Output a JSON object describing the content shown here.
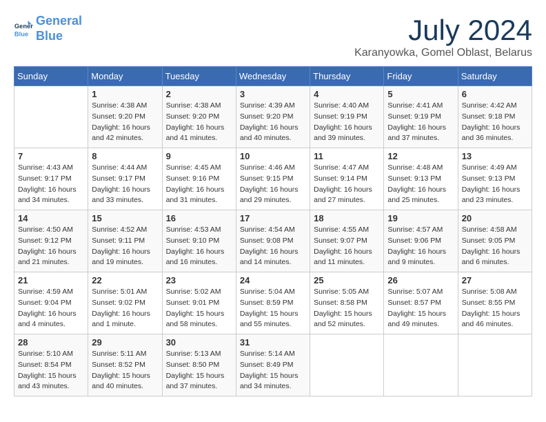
{
  "header": {
    "logo_line1": "General",
    "logo_line2": "Blue",
    "month_title": "July 2024",
    "subtitle": "Karanyowka, Gomel Oblast, Belarus"
  },
  "weekdays": [
    "Sunday",
    "Monday",
    "Tuesday",
    "Wednesday",
    "Thursday",
    "Friday",
    "Saturday"
  ],
  "weeks": [
    [
      {
        "day": "",
        "sunrise": "",
        "sunset": "",
        "daylight": ""
      },
      {
        "day": "1",
        "sunrise": "Sunrise: 4:38 AM",
        "sunset": "Sunset: 9:20 PM",
        "daylight": "Daylight: 16 hours and 42 minutes."
      },
      {
        "day": "2",
        "sunrise": "Sunrise: 4:38 AM",
        "sunset": "Sunset: 9:20 PM",
        "daylight": "Daylight: 16 hours and 41 minutes."
      },
      {
        "day": "3",
        "sunrise": "Sunrise: 4:39 AM",
        "sunset": "Sunset: 9:20 PM",
        "daylight": "Daylight: 16 hours and 40 minutes."
      },
      {
        "day": "4",
        "sunrise": "Sunrise: 4:40 AM",
        "sunset": "Sunset: 9:19 PM",
        "daylight": "Daylight: 16 hours and 39 minutes."
      },
      {
        "day": "5",
        "sunrise": "Sunrise: 4:41 AM",
        "sunset": "Sunset: 9:19 PM",
        "daylight": "Daylight: 16 hours and 37 minutes."
      },
      {
        "day": "6",
        "sunrise": "Sunrise: 4:42 AM",
        "sunset": "Sunset: 9:18 PM",
        "daylight": "Daylight: 16 hours and 36 minutes."
      }
    ],
    [
      {
        "day": "7",
        "sunrise": "Sunrise: 4:43 AM",
        "sunset": "Sunset: 9:17 PM",
        "daylight": "Daylight: 16 hours and 34 minutes."
      },
      {
        "day": "8",
        "sunrise": "Sunrise: 4:44 AM",
        "sunset": "Sunset: 9:17 PM",
        "daylight": "Daylight: 16 hours and 33 minutes."
      },
      {
        "day": "9",
        "sunrise": "Sunrise: 4:45 AM",
        "sunset": "Sunset: 9:16 PM",
        "daylight": "Daylight: 16 hours and 31 minutes."
      },
      {
        "day": "10",
        "sunrise": "Sunrise: 4:46 AM",
        "sunset": "Sunset: 9:15 PM",
        "daylight": "Daylight: 16 hours and 29 minutes."
      },
      {
        "day": "11",
        "sunrise": "Sunrise: 4:47 AM",
        "sunset": "Sunset: 9:14 PM",
        "daylight": "Daylight: 16 hours and 27 minutes."
      },
      {
        "day": "12",
        "sunrise": "Sunrise: 4:48 AM",
        "sunset": "Sunset: 9:13 PM",
        "daylight": "Daylight: 16 hours and 25 minutes."
      },
      {
        "day": "13",
        "sunrise": "Sunrise: 4:49 AM",
        "sunset": "Sunset: 9:13 PM",
        "daylight": "Daylight: 16 hours and 23 minutes."
      }
    ],
    [
      {
        "day": "14",
        "sunrise": "Sunrise: 4:50 AM",
        "sunset": "Sunset: 9:12 PM",
        "daylight": "Daylight: 16 hours and 21 minutes."
      },
      {
        "day": "15",
        "sunrise": "Sunrise: 4:52 AM",
        "sunset": "Sunset: 9:11 PM",
        "daylight": "Daylight: 16 hours and 19 minutes."
      },
      {
        "day": "16",
        "sunrise": "Sunrise: 4:53 AM",
        "sunset": "Sunset: 9:10 PM",
        "daylight": "Daylight: 16 hours and 16 minutes."
      },
      {
        "day": "17",
        "sunrise": "Sunrise: 4:54 AM",
        "sunset": "Sunset: 9:08 PM",
        "daylight": "Daylight: 16 hours and 14 minutes."
      },
      {
        "day": "18",
        "sunrise": "Sunrise: 4:55 AM",
        "sunset": "Sunset: 9:07 PM",
        "daylight": "Daylight: 16 hours and 11 minutes."
      },
      {
        "day": "19",
        "sunrise": "Sunrise: 4:57 AM",
        "sunset": "Sunset: 9:06 PM",
        "daylight": "Daylight: 16 hours and 9 minutes."
      },
      {
        "day": "20",
        "sunrise": "Sunrise: 4:58 AM",
        "sunset": "Sunset: 9:05 PM",
        "daylight": "Daylight: 16 hours and 6 minutes."
      }
    ],
    [
      {
        "day": "21",
        "sunrise": "Sunrise: 4:59 AM",
        "sunset": "Sunset: 9:04 PM",
        "daylight": "Daylight: 16 hours and 4 minutes."
      },
      {
        "day": "22",
        "sunrise": "Sunrise: 5:01 AM",
        "sunset": "Sunset: 9:02 PM",
        "daylight": "Daylight: 16 hours and 1 minute."
      },
      {
        "day": "23",
        "sunrise": "Sunrise: 5:02 AM",
        "sunset": "Sunset: 9:01 PM",
        "daylight": "Daylight: 15 hours and 58 minutes."
      },
      {
        "day": "24",
        "sunrise": "Sunrise: 5:04 AM",
        "sunset": "Sunset: 8:59 PM",
        "daylight": "Daylight: 15 hours and 55 minutes."
      },
      {
        "day": "25",
        "sunrise": "Sunrise: 5:05 AM",
        "sunset": "Sunset: 8:58 PM",
        "daylight": "Daylight: 15 hours and 52 minutes."
      },
      {
        "day": "26",
        "sunrise": "Sunrise: 5:07 AM",
        "sunset": "Sunset: 8:57 PM",
        "daylight": "Daylight: 15 hours and 49 minutes."
      },
      {
        "day": "27",
        "sunrise": "Sunrise: 5:08 AM",
        "sunset": "Sunset: 8:55 PM",
        "daylight": "Daylight: 15 hours and 46 minutes."
      }
    ],
    [
      {
        "day": "28",
        "sunrise": "Sunrise: 5:10 AM",
        "sunset": "Sunset: 8:54 PM",
        "daylight": "Daylight: 15 hours and 43 minutes."
      },
      {
        "day": "29",
        "sunrise": "Sunrise: 5:11 AM",
        "sunset": "Sunset: 8:52 PM",
        "daylight": "Daylight: 15 hours and 40 minutes."
      },
      {
        "day": "30",
        "sunrise": "Sunrise: 5:13 AM",
        "sunset": "Sunset: 8:50 PM",
        "daylight": "Daylight: 15 hours and 37 minutes."
      },
      {
        "day": "31",
        "sunrise": "Sunrise: 5:14 AM",
        "sunset": "Sunset: 8:49 PM",
        "daylight": "Daylight: 15 hours and 34 minutes."
      },
      {
        "day": "",
        "sunrise": "",
        "sunset": "",
        "daylight": ""
      },
      {
        "day": "",
        "sunrise": "",
        "sunset": "",
        "daylight": ""
      },
      {
        "day": "",
        "sunrise": "",
        "sunset": "",
        "daylight": ""
      }
    ]
  ]
}
